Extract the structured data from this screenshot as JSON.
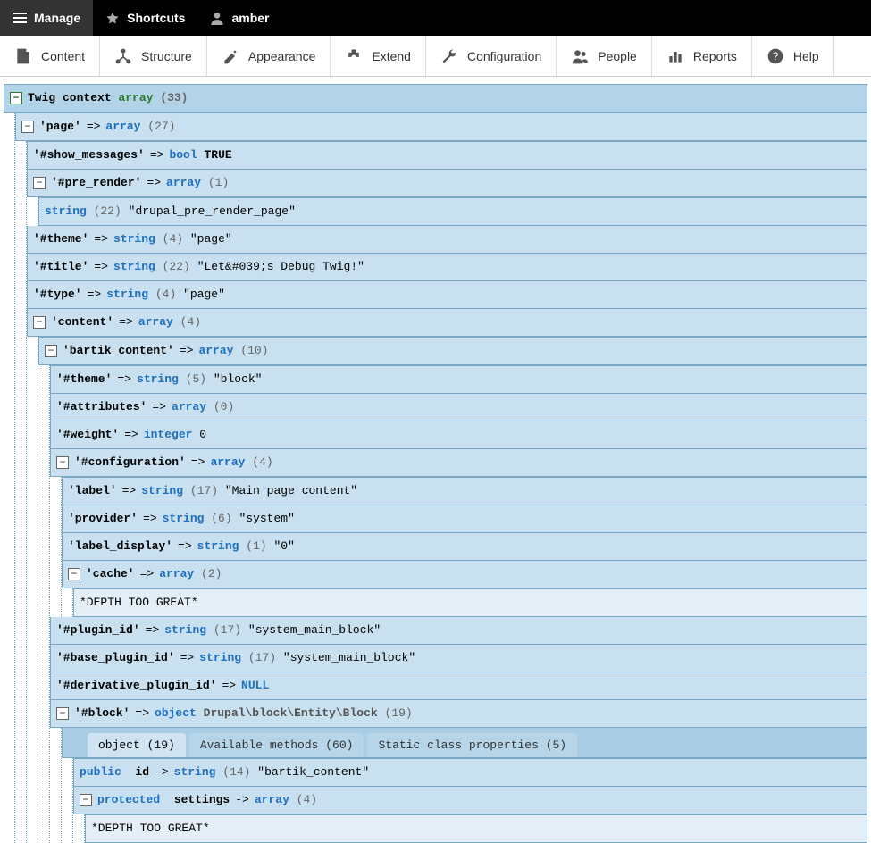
{
  "topbar": {
    "manage": "Manage",
    "shortcuts": "Shortcuts",
    "user": "amber"
  },
  "adminbar": {
    "content": "Content",
    "structure": "Structure",
    "appearance": "Appearance",
    "extend": "Extend",
    "configuration": "Configuration",
    "people": "People",
    "reports": "Reports",
    "help": "Help"
  },
  "root": {
    "label": "Twig context",
    "type": "array",
    "count": "(33)"
  },
  "page": {
    "key": "'page'",
    "type": "array",
    "count": "(27)"
  },
  "show_messages": {
    "key": "'#show_messages'",
    "type": "bool",
    "val": "TRUE"
  },
  "pre_render": {
    "key": "'#pre_render'",
    "type": "array",
    "count": "(1)"
  },
  "pre_render_item": {
    "type": "string",
    "count": "(22)",
    "val": "\"drupal_pre_render_page\""
  },
  "theme1": {
    "key": "'#theme'",
    "type": "string",
    "count": "(4)",
    "val": "\"page\""
  },
  "title": {
    "key": "'#title'",
    "type": "string",
    "count": "(22)",
    "val": "\"Let&#039;s Debug Twig!\""
  },
  "type1": {
    "key": "'#type'",
    "type": "string",
    "count": "(4)",
    "val": "\"page\""
  },
  "content": {
    "key": "'content'",
    "type": "array",
    "count": "(4)"
  },
  "bartik": {
    "key": "'bartik_content'",
    "type": "array",
    "count": "(10)"
  },
  "theme2": {
    "key": "'#theme'",
    "type": "string",
    "count": "(5)",
    "val": "\"block\""
  },
  "attributes": {
    "key": "'#attributes'",
    "type": "array",
    "count": "(0)"
  },
  "weight": {
    "key": "'#weight'",
    "type": "integer",
    "val": "0"
  },
  "config": {
    "key": "'#configuration'",
    "type": "array",
    "count": "(4)"
  },
  "cfg_label": {
    "key": "'label'",
    "type": "string",
    "count": "(17)",
    "val": "\"Main page content\""
  },
  "cfg_provider": {
    "key": "'provider'",
    "type": "string",
    "count": "(6)",
    "val": "\"system\""
  },
  "cfg_labeldisp": {
    "key": "'label_display'",
    "type": "string",
    "count": "(1)",
    "val": "\"0\""
  },
  "cfg_cache": {
    "key": "'cache'",
    "type": "array",
    "count": "(2)"
  },
  "depth": "*DEPTH TOO GREAT*",
  "plugin_id": {
    "key": "'#plugin_id'",
    "type": "string",
    "count": "(17)",
    "val": "\"system_main_block\""
  },
  "base_plugin_id": {
    "key": "'#base_plugin_id'",
    "type": "string",
    "count": "(17)",
    "val": "\"system_main_block\""
  },
  "deriv": {
    "key": "'#derivative_plugin_id'",
    "val": "NULL"
  },
  "block": {
    "key": "'#block'",
    "type": "object",
    "cls": "Drupal\\block\\Entity\\Block",
    "count": "(19)"
  },
  "tabs": {
    "t1": "object (19)",
    "t2": "Available methods (60)",
    "t3": "Static class properties (5)"
  },
  "obj_id": {
    "vis": "public",
    "name": "id",
    "type": "string",
    "count": "(14)",
    "val": "\"bartik_content\""
  },
  "obj_settings": {
    "vis": "protected",
    "name": "settings",
    "type": "array",
    "count": "(4)"
  }
}
